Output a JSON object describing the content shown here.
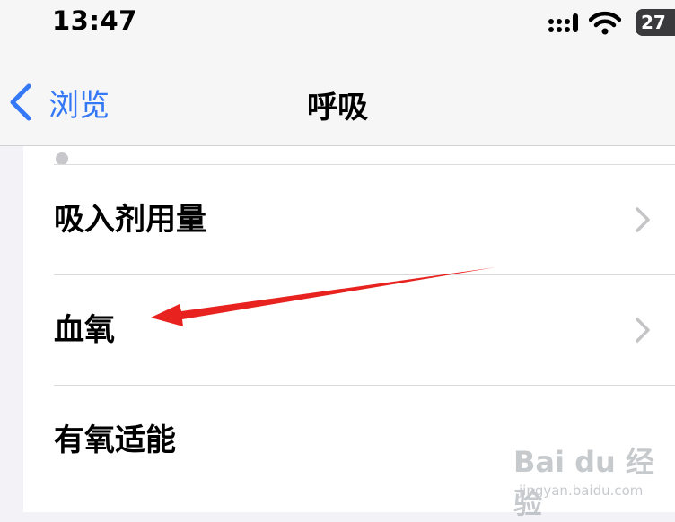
{
  "status_bar": {
    "time": "13:47",
    "battery": "27"
  },
  "nav": {
    "back_label": "浏览",
    "title": "呼吸"
  },
  "rows": [
    {
      "label": "吸入剂用量"
    },
    {
      "label": "血氧"
    },
    {
      "label": "有氧适能"
    }
  ],
  "colors": {
    "accent": "#3478f6",
    "annotation_arrow": "#e8221f",
    "background": "#f2f2f7"
  },
  "watermark": {
    "brand": "Bai du 经验",
    "url": "jingyan.baidu.com"
  }
}
